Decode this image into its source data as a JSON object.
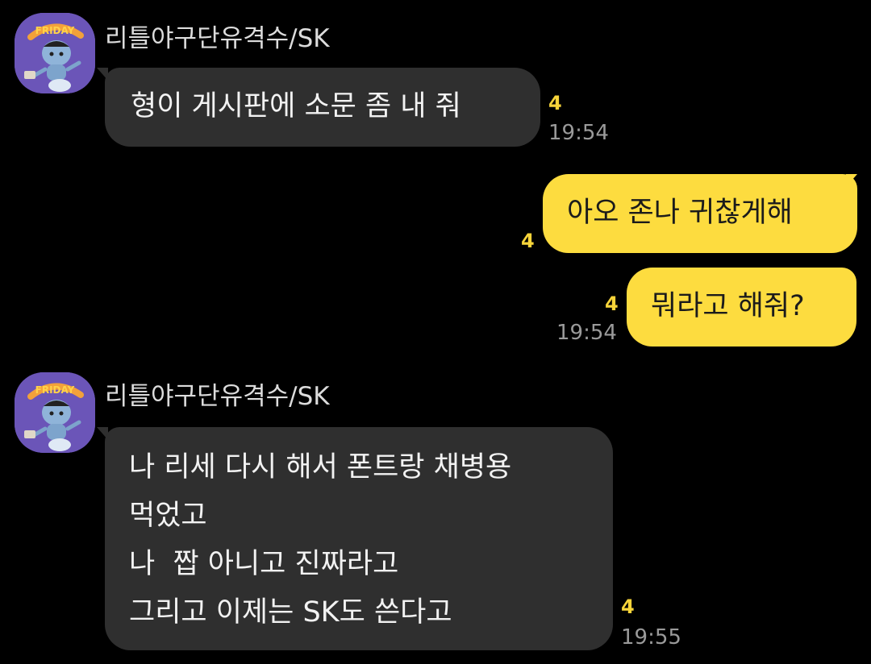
{
  "chat": {
    "messages": [
      {
        "sender": "리틀야구단유격수/SK",
        "lines": [
          "형이 게시판에 소문 좀 내 줘"
        ],
        "unread": "4",
        "time": "19:54"
      },
      {
        "lines": [
          "아오 존나 귀찮게해"
        ],
        "unread": "4"
      },
      {
        "lines": [
          "뭐라고 해줘?"
        ],
        "unread": "4",
        "time": "19:54"
      },
      {
        "sender": "리틀야구단유격수/SK",
        "lines": [
          "나 리세 다시 해서 폰트랑 채병용",
          "먹었고",
          "나  짭 아니고 진짜라고",
          "그리고 이제는 SK도 쓴다고"
        ],
        "unread": "4",
        "time": "19:55"
      }
    ],
    "avatar": {
      "badge_text": "FRIDAY",
      "bg_color": "#6b55b8"
    }
  },
  "colors": {
    "background": "#000000",
    "incoming_bubble": "#2f2f2f",
    "outgoing_bubble": "#fddc3f",
    "unread": "#f7d43a",
    "time": "#9a9a9a"
  }
}
